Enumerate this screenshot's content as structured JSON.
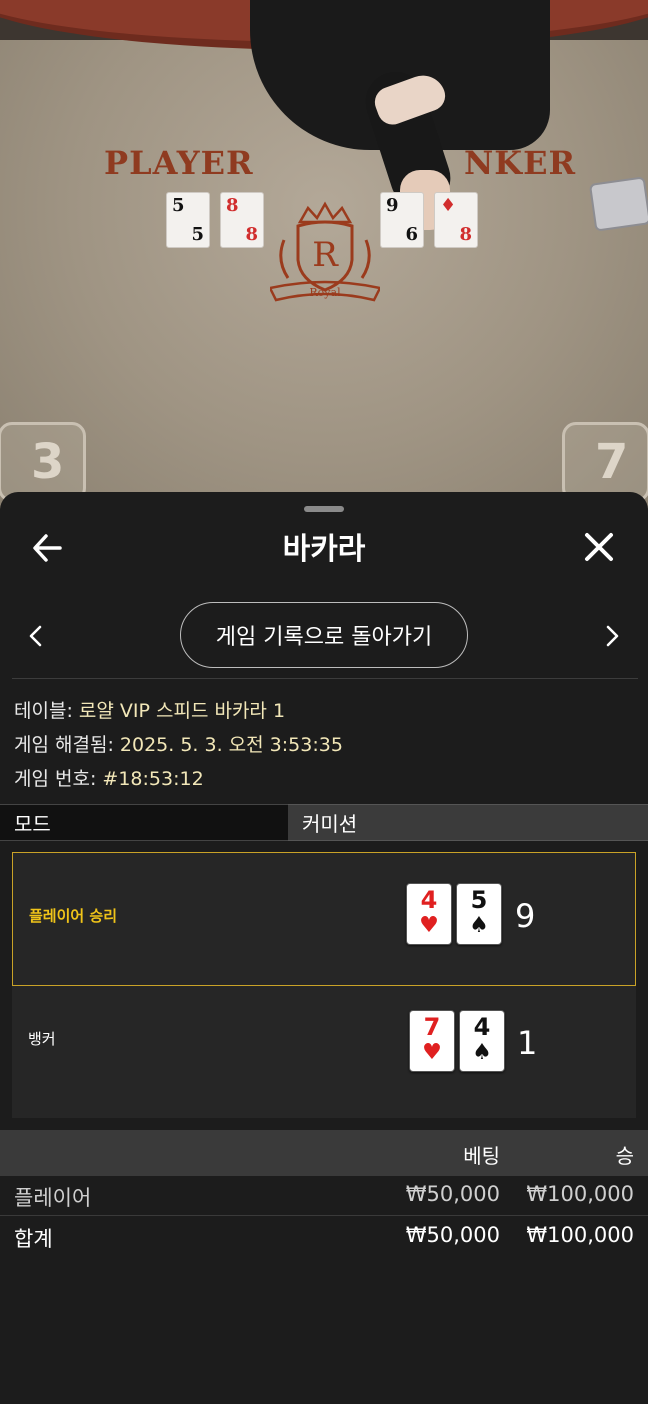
{
  "video": {
    "felt_left": "PLAYER",
    "felt_right": "NKER",
    "crest_text": "Royal",
    "crest_letter": "R",
    "table_cards": [
      {
        "top": "5",
        "bottom": "5",
        "suit": "♠",
        "color": "black"
      },
      {
        "top": "8",
        "bottom": "8",
        "suit": "♥",
        "color": "red"
      },
      {
        "top": "9",
        "bottom": "6",
        "suit": "♠",
        "color": "black"
      },
      {
        "top": "♦",
        "bottom": "8",
        "suit": "♦",
        "color": "red"
      }
    ],
    "score_left": "3",
    "score_right": "7"
  },
  "header": {
    "title": "바카라"
  },
  "nav": {
    "history_button": "게임 기록으로 돌아가기"
  },
  "info": {
    "table_label": "테이블:",
    "table_value": "로얄 VIP 스피드 바카라 1",
    "resolved_label": "게임 해결됨:",
    "resolved_value": "2025. 5. 3. 오전 3:53:35",
    "number_label": "게임 번호:",
    "number_value": "#18:53:12"
  },
  "tabs": {
    "mode": "모드",
    "commission": "커미션"
  },
  "results": {
    "player": {
      "label": "플레이어 승리",
      "cards": [
        {
          "rank": "4",
          "suit": "♥",
          "color": "red"
        },
        {
          "rank": "5",
          "suit": "♠",
          "color": "black"
        }
      ],
      "total": "9"
    },
    "banker": {
      "label": "뱅커",
      "cards": [
        {
          "rank": "7",
          "suit": "♥",
          "color": "red"
        },
        {
          "rank": "4",
          "suit": "♠",
          "color": "black"
        }
      ],
      "total": "1"
    }
  },
  "bets": {
    "header_bet": "베팅",
    "header_win": "승",
    "rows": [
      {
        "name": "플레이어",
        "bet": "₩50,000",
        "win": "₩100,000"
      }
    ],
    "total": {
      "name": "합계",
      "bet": "₩50,000",
      "win": "₩100,000"
    }
  },
  "colors": {
    "accent_gold": "#c9a227",
    "winner_text": "#f0c419",
    "info_value": "#f2e7b8",
    "felt_text": "#8f3b20"
  }
}
